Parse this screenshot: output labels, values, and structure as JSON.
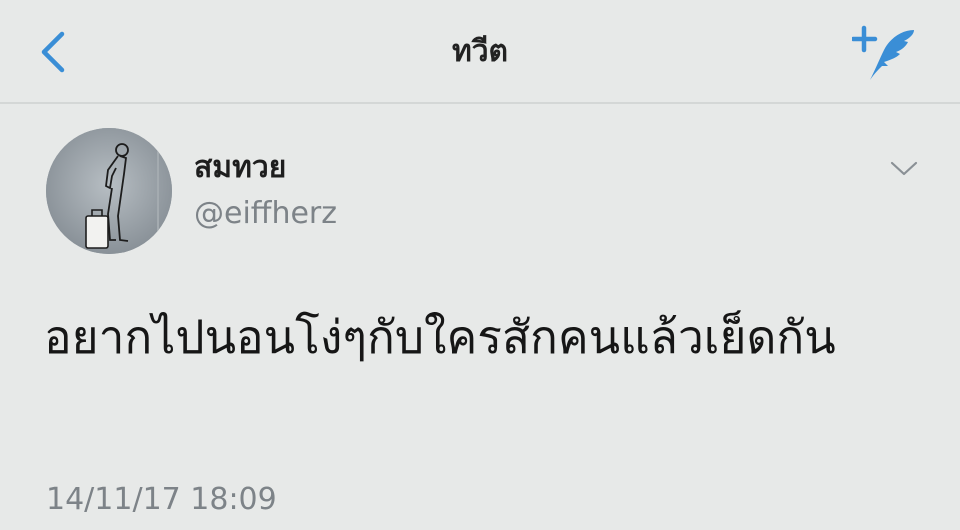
{
  "header": {
    "title": "ทวีต",
    "back_icon": "chevron-left-icon",
    "compose_icon": "compose-tweet-icon",
    "accent_color": "#3a8ed6"
  },
  "tweet": {
    "author": {
      "display_name": "สมทวย",
      "handle": "@eiffherz",
      "avatar": "avatar-sketch-person-with-suitcase"
    },
    "text": "อยากไปนอนโง่ๆกับใครสักคนแล้วเย็ดกัน",
    "timestamp": "14/11/17 18:09",
    "menu_icon": "chevron-down-icon"
  }
}
